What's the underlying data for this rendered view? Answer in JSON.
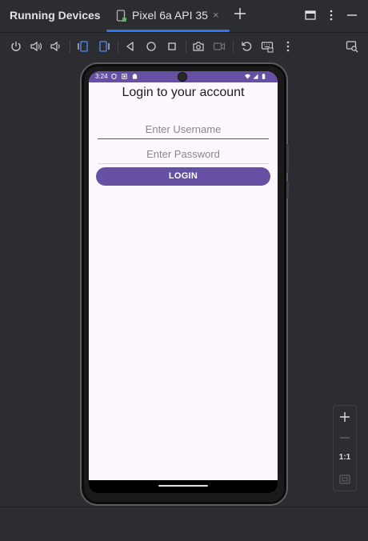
{
  "header": {
    "panel_title": "Running Devices",
    "tab_label": "Pixel 6a API 35",
    "tab_close": "×",
    "icons": [
      "device-tab-icon",
      "close-icon",
      "plus-icon",
      "window-icon",
      "more-vertical-icon",
      "minimize-icon"
    ]
  },
  "toolbar": {
    "icons": [
      "power-icon",
      "volume-up-icon",
      "volume-down-icon",
      "rotate-left-icon",
      "rotate-right-icon",
      "back-icon",
      "home-icon",
      "overview-icon",
      "camera-icon",
      "screen-record-icon",
      "reset-icon",
      "keyboard-icon",
      "more-vertical-icon",
      "device-explorer-icon"
    ]
  },
  "device": {
    "status_time": "3:24",
    "status_icons": [
      "shield-icon",
      "notification-icon",
      "battery-saver-icon",
      "wifi-icon",
      "signal-icon",
      "battery-icon"
    ],
    "screen": {
      "title": "Login to your account",
      "username_placeholder": "Enter Username",
      "password_placeholder": "Enter Password",
      "login_label": "LOGIN"
    }
  },
  "zoom": {
    "ratio_label": "1:1",
    "icons": [
      "zoom-in-icon",
      "zoom-out-icon",
      "fit-screen-icon"
    ]
  },
  "colors": {
    "ide_background": "#2b2d30",
    "tab_accent": "#3574f0",
    "app_primary": "#6650a4",
    "screen_background": "#fdf7ff"
  }
}
